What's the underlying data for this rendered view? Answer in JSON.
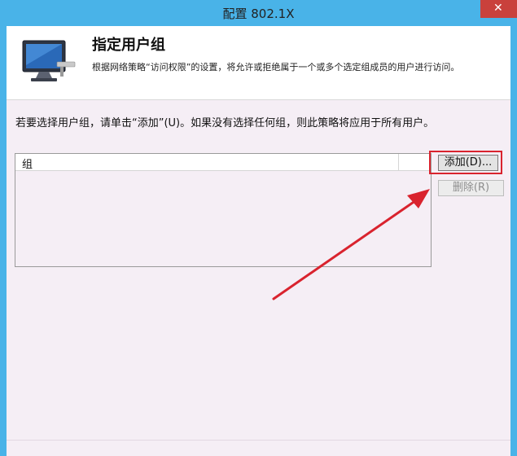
{
  "window": {
    "title": "配置 802.1X",
    "close_glyph": "✕"
  },
  "header": {
    "title": "指定用户组",
    "description": "根据网络策略“访问权限”的设置，将允许或拒绝属于一个或多个选定组成员的用户进行访问。"
  },
  "instruction": "若要选择用户组，请单击“添加”(U)。如果没有选择任何组，则此策略将应用于所有用户。",
  "group_list": {
    "column_header": "组",
    "rows": []
  },
  "buttons": {
    "add": "添加(D)...",
    "remove": "删除(R)"
  },
  "annotation": {
    "color": "#d9232e"
  }
}
